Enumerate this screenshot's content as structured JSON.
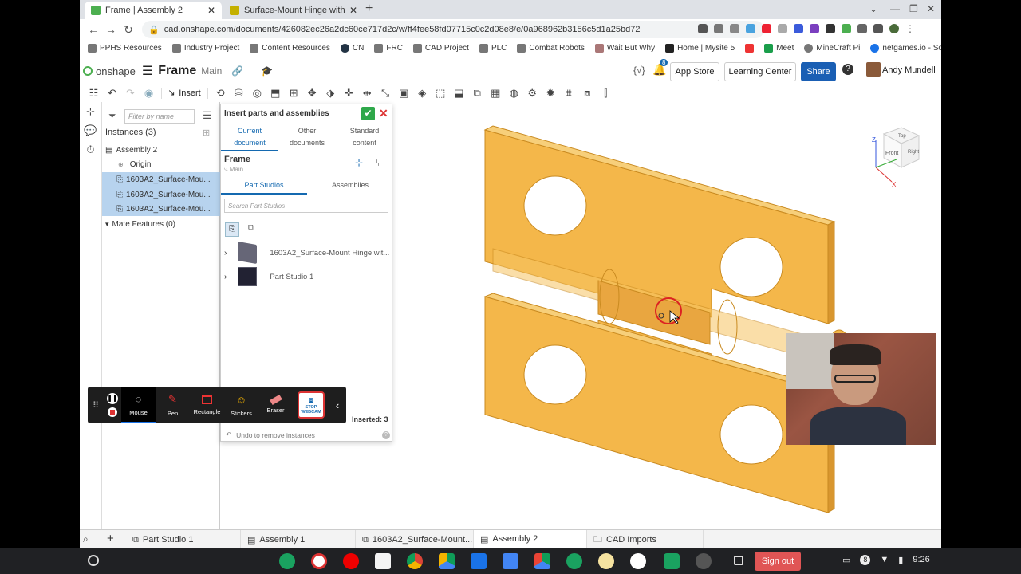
{
  "browser": {
    "tabs": [
      {
        "title": "Frame | Assembly 2",
        "color": "#4caf50"
      },
      {
        "title": "Surface-Mount Hinge with Holes",
        "color": "#c4b000"
      }
    ],
    "url": "cad.onshape.com/documents/426082ec26a2dc60ce717d2c/w/ff4fee58fd07715c0c2d08e8/e/0a968962b3156c5d1a25bd72",
    "bookmarks": [
      "PPHS Resources",
      "Industry Project",
      "Content Resources",
      "CN",
      "FRC",
      "CAD Project",
      "PLC",
      "Combat Robots",
      "Wait But Why",
      "Home | Mysite 5",
      "Meet",
      "MineCraft Pi",
      "netgames.io - Socia..."
    ]
  },
  "app": {
    "logo": "onshape",
    "doc_title": "Frame",
    "branch": "Main",
    "code_icon": "{√}",
    "notif_count": "8",
    "app_store": "App Store",
    "learning_center": "Learning Center",
    "share": "Share",
    "help": "?",
    "user": "Andy Mundell",
    "insert_label": "Insert"
  },
  "instances": {
    "filter_placeholder": "Filter by name",
    "header": "Instances (3)",
    "tree": [
      {
        "label": "Assembly 2",
        "indent": 1,
        "selected": false
      },
      {
        "label": "Origin",
        "indent": 2,
        "selected": false
      },
      {
        "label": "1603A2_Surface-Mou...",
        "indent": 2,
        "selected": true
      },
      {
        "label": "1603A2_Surface-Mou...",
        "indent": 2,
        "selected": true
      },
      {
        "label": "1603A2_Surface-Mou...",
        "indent": 2,
        "selected": true
      }
    ],
    "mate_features": "Mate Features (0)"
  },
  "dialog": {
    "title": "Insert parts and assemblies",
    "tabs": [
      {
        "line1": "Current",
        "line2": "document",
        "active": true
      },
      {
        "line1": "Other",
        "line2": "documents",
        "active": false
      },
      {
        "line1": "Standard",
        "line2": "content",
        "active": false
      }
    ],
    "doc_name": "Frame",
    "doc_branch": "Main",
    "sub_tabs": [
      "Part Studios",
      "Assemblies"
    ],
    "search_placeholder": "Search Part Studios",
    "items": [
      "1603A2_Surface-Mount Hinge wit...",
      "Part Studio 1"
    ],
    "inserted": "Inserted: 3",
    "undo": "Undo to remove instances"
  },
  "annotation_toolbar": [
    "Mouse",
    "Pen",
    "Rectangle",
    "Stickers",
    "Eraser",
    "STOP WEBCAM"
  ],
  "view_cube": {
    "top": "Top",
    "front": "Front",
    "right": "Right",
    "z": "Z",
    "x": "X"
  },
  "bottom_tabs": [
    {
      "label": "Part Studio 1",
      "active": false
    },
    {
      "label": "Assembly 1",
      "active": false
    },
    {
      "label": "1603A2_Surface-Mount...",
      "active": false
    },
    {
      "label": "Assembly 2",
      "active": true
    },
    {
      "label": "CAD Imports",
      "active": false
    }
  ],
  "taskbar": {
    "sign_out": "Sign out",
    "notif": "8",
    "time": "9:26"
  },
  "colors": {
    "accent": "#1469b0",
    "part": "#f2b44a",
    "selection": "#b7d3ee",
    "share": "#1a5fb4"
  }
}
